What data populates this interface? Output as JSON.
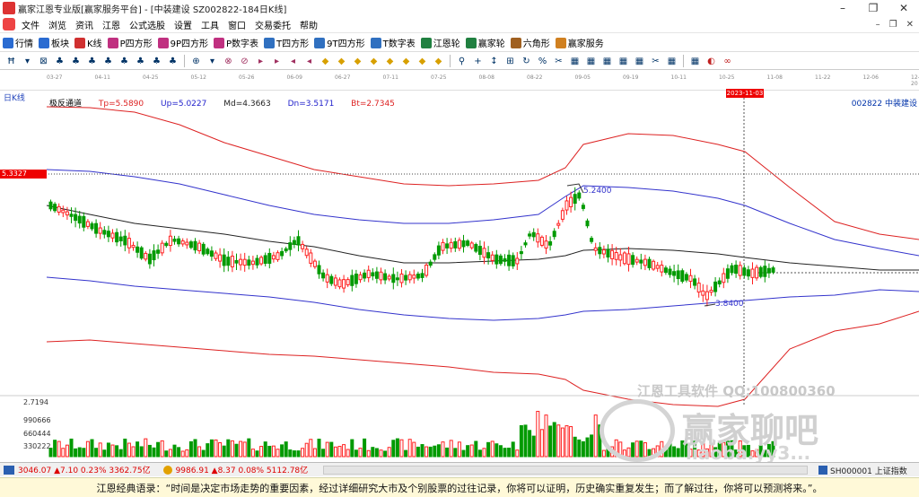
{
  "window": {
    "title": "赢家江恩专业版[赢家服务平台] - [中装建设  SZ002822-184日K线]",
    "controls": [
      "–",
      "❐",
      "✕"
    ]
  },
  "menu": {
    "items": [
      "文件",
      "浏览",
      "资讯",
      "江恩",
      "公式选股",
      "设置",
      "工具",
      "窗口",
      "交易委托",
      "帮助"
    ],
    "mdi": [
      "–",
      "❐",
      "✕"
    ]
  },
  "toolbar": {
    "items": [
      {
        "label": "行情",
        "icon": "quotes-icon",
        "color": "#2a6bd1"
      },
      {
        "label": "板块",
        "icon": "sector-icon",
        "color": "#2a6bd1"
      },
      {
        "label": "K线",
        "icon": "kline-icon",
        "color": "#d03030"
      },
      {
        "label": "P四方形",
        "icon": "p-square-icon",
        "color": "#c03080"
      },
      {
        "label": "9P四方形",
        "icon": "9p-square-icon",
        "color": "#c03080"
      },
      {
        "label": "P数字表",
        "icon": "p-table-icon",
        "color": "#c03080"
      },
      {
        "label": "T四方形",
        "icon": "t-square-icon",
        "color": "#3070c0"
      },
      {
        "label": "9T四方形",
        "icon": "9t-square-icon",
        "color": "#3070c0"
      },
      {
        "label": "T数字表",
        "icon": "t-table-icon",
        "color": "#3070c0"
      },
      {
        "label": "江恩轮",
        "icon": "gann-wheel-icon",
        "color": "#208040"
      },
      {
        "label": "赢家轮",
        "icon": "winner-wheel-icon",
        "color": "#208040"
      },
      {
        "label": "六角形",
        "icon": "hexagon-icon",
        "color": "#a06020"
      },
      {
        "label": "赢家服务",
        "icon": "service-icon",
        "color": "#d08020"
      }
    ]
  },
  "drawing_toolbar": {
    "glyphs": [
      "Ħ",
      "▾",
      "⊠",
      "♣",
      "♣",
      "♣",
      "♣",
      "♣",
      "♣",
      "♣",
      "♣",
      "⊕",
      "▾",
      "⊗",
      "⊘",
      "▸",
      "▸",
      "◂",
      "◂",
      "◆",
      "◆",
      "◆",
      "◆",
      "◆",
      "◆",
      "◆",
      "◆",
      "⚲",
      "+",
      "↕",
      "⊞",
      "↻",
      "%",
      "✂",
      "▦",
      "▦",
      "▦",
      "▦",
      "▦",
      "✂",
      "▦",
      "▦",
      "◐",
      "∞"
    ]
  },
  "chart_header": {
    "period": "日K线",
    "indicator": "极反通道",
    "tp": "Tp=5.5890",
    "up": "Up=5.0227",
    "md": "Md=4.3663",
    "dn": "Dn=3.5171",
    "bt": "Bt=2.7345",
    "stock": "002822  中装建设",
    "price_tag": "5.3327",
    "date_tag": "2023-11-03",
    "dates": [
      "03-27",
      "04-11",
      "04-25",
      "05-12",
      "05-26",
      "06-09",
      "06-27",
      "07-11",
      "07-25",
      "08-08",
      "08-22",
      "09-05",
      "09-19",
      "10-11",
      "10-25",
      "11-08",
      "11-22",
      "12-06",
      "12-20"
    ],
    "label_high": "5.2400",
    "label_low": "3.8400",
    "vol_labels": [
      "2.7194",
      "990666",
      "660444",
      "330222"
    ]
  },
  "colors": {
    "up_candle": "#ff2020",
    "down_candle": "#009a00",
    "tp_bt": "#dd2222",
    "up_dn": "#3333cc",
    "md": "#222222",
    "crosshair": "#555555"
  },
  "watermark": {
    "line1": "江恩工具软件 QQ:100800360",
    "line2": "赢家聊吧",
    "line3": "liaoba.yy3..."
  },
  "status": {
    "sh": "3046.07 ▲7.10 0.23% 3362.75亿",
    "sz": "9986.91 ▲8.37 0.08% 5112.78亿",
    "index": "SH000001 上证指数"
  },
  "quote": "江恩经典语录：“时间是决定市场走势的重要因素，经过详细研究大市及个别股票的过往记录，你将可以证明，历史确实重复发生；而了解过往，你将可以预测将来。”。",
  "chart_data": {
    "type": "candlestick",
    "title": "极反通道",
    "ylim": [
      2.7,
      5.9
    ],
    "series_names": [
      "Tp",
      "Up",
      "Md",
      "Dn",
      "Bt"
    ],
    "last_values": {
      "Tp": 5.589,
      "Up": 5.0227,
      "Md": 4.3663,
      "Dn": 3.5171,
      "Bt": 2.7345
    },
    "annotations": [
      {
        "text": "5.2400",
        "value": 5.24
      },
      {
        "text": "3.8400",
        "value": 3.84
      }
    ]
  }
}
